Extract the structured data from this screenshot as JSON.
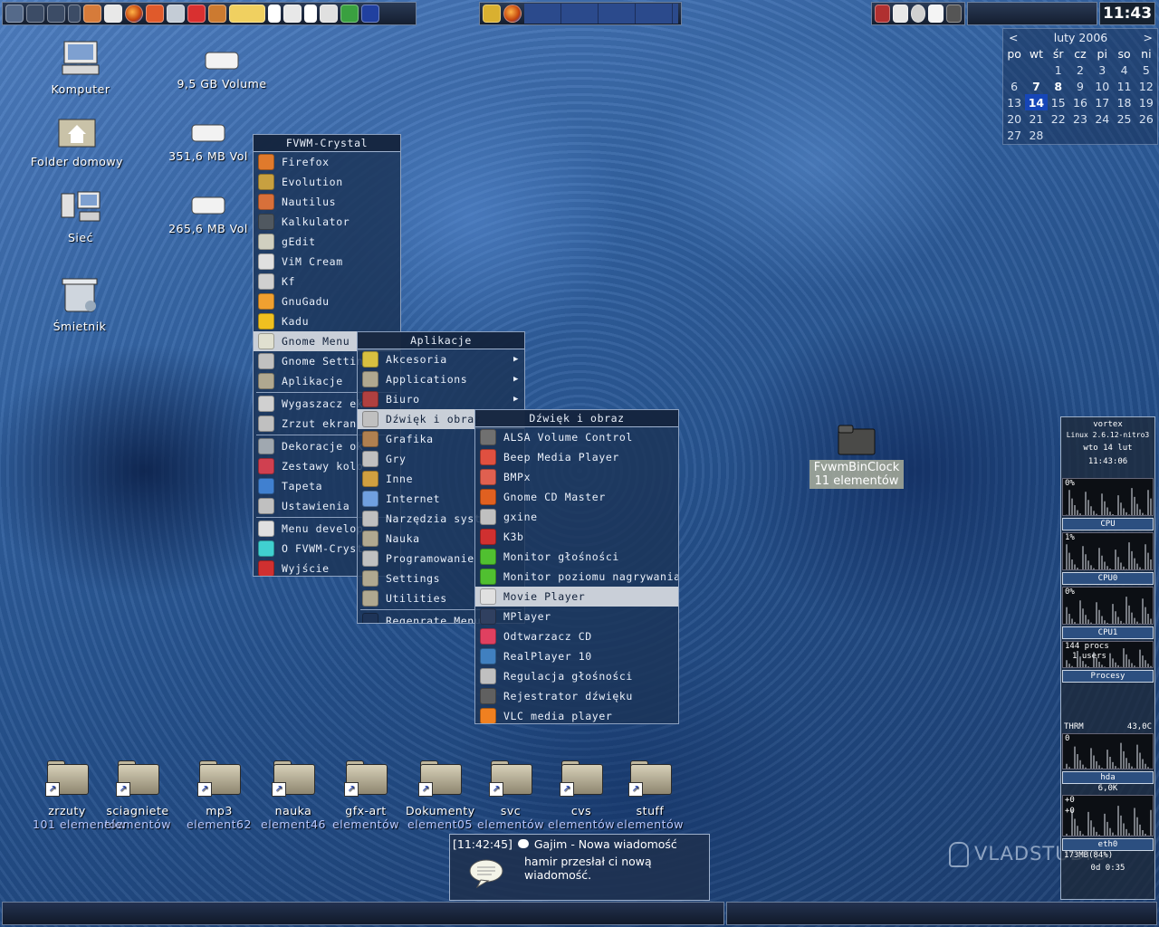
{
  "panel": {
    "clock": "11:43"
  },
  "calendar": {
    "prev": "<",
    "next": ">",
    "month": "luty 2006",
    "weekdays": [
      "po",
      "wt",
      "śr",
      "cz",
      "pi",
      "so",
      "ni"
    ],
    "weeks": [
      [
        "",
        "",
        "1",
        "2",
        "3",
        "4",
        "5"
      ],
      [
        "6",
        "7",
        "8",
        "9",
        "10",
        "11",
        "12"
      ],
      [
        "13",
        "14",
        "15",
        "16",
        "17",
        "18",
        "19"
      ],
      [
        "20",
        "21",
        "22",
        "23",
        "24",
        "25",
        "26"
      ],
      [
        "27",
        "28",
        "",
        "",
        "",
        "",
        ""
      ]
    ],
    "today": "14",
    "bold_days": [
      "7",
      "8"
    ]
  },
  "desktop_icons": [
    {
      "label": "Komputer"
    },
    {
      "label": "9,5 GB Volume"
    },
    {
      "label": "Folder domowy"
    },
    {
      "label": "351,6 MB Vol"
    },
    {
      "label": "Sieć"
    },
    {
      "label": "265,6 MB Vol"
    },
    {
      "label": "Śmietnik"
    }
  ],
  "fvwm_binclock": {
    "label": "FvwmBinClock",
    "sub": "11 elementów"
  },
  "menu_main": {
    "title": "FVWM-Crystal",
    "items": [
      "Firefox",
      "Evolution",
      "Nautilus",
      "Kalkulator",
      "gEdit",
      "ViM Cream",
      "Kf",
      "GnuGadu",
      "Kadu",
      "Gnome Menu",
      "Gnome Settin",
      "Aplikacje",
      "Wygaszacz ek",
      "Zrzut ekranu",
      "Dekoracje ok",
      "Zestawy kolo",
      "Tapeta",
      "Ustawienia",
      "Menu develop",
      "O FVWM-Cryst",
      "Wyjście"
    ]
  },
  "menu_apps": {
    "title": "Aplikacje",
    "items": [
      "Akcesoria",
      "Applications",
      "Biuro",
      "Dźwięk i obraz",
      "Grafika",
      "Gry",
      "Inne",
      "Internet",
      "Narzędzia syst",
      "Nauka",
      "Programowanie",
      "Settings",
      "Utilities",
      "Regenrate Menu"
    ]
  },
  "menu_sound": {
    "title": "Dźwięk i obraz",
    "items": [
      "ALSA Volume Control",
      "Beep Media Player",
      "BMPx",
      "Gnome CD Master",
      "gxine",
      "K3b",
      "Monitor głośności",
      "Monitor poziomu nagrywania",
      "Movie Player",
      "MPlayer",
      "Odtwarzacz CD",
      "RealPlayer 10",
      "Regulacja głośności",
      "Rejestrator dźwięku",
      "VLC media player"
    ]
  },
  "dock": [
    {
      "label": "zrzuty",
      "sub": "101 elementów"
    },
    {
      "label": "sciagniete",
      "sub": "elementów"
    },
    {
      "label": "mp3",
      "sub": "element62"
    },
    {
      "label": "nauka",
      "sub": "element46"
    },
    {
      "label": "gfx-art",
      "sub": "elementów"
    },
    {
      "label": "Dokumenty",
      "sub": "element05"
    },
    {
      "label": "svc",
      "sub": "elementów"
    },
    {
      "label": "cvs",
      "sub": "elementów"
    },
    {
      "label": "stuff",
      "sub": "elementów"
    }
  ],
  "notification": {
    "time": "[11:42:45]",
    "app": "Gajim - Nowa wiadomość",
    "body": "hamir przesłał ci nową wiadomość."
  },
  "sysmon": {
    "host": "vortex",
    "kernel": "Linux 2.6.12-nitro3",
    "date": "wto 14 lut",
    "time": "11:43:06",
    "cpu_pct": "0%",
    "cpu0_pct": "1%",
    "cpu1_pct": "0%",
    "cpu_label": "CPU",
    "cpu0_label": "CPU0",
    "cpu1_label": "CPU1",
    "procs": "144 procs",
    "users": "1 users",
    "procs_label": "Procesy",
    "therm": "THRM",
    "temp": "43,0C",
    "disk_val": "0",
    "hda_label": "hda",
    "hda_rate": "6,0K",
    "eth_top": "+0",
    "eth_mid": "+0",
    "eth_label": "eth0",
    "mem": "173MB(84%)",
    "uptime": "0d  0:35"
  },
  "watermark": "VLADSTUDIO"
}
